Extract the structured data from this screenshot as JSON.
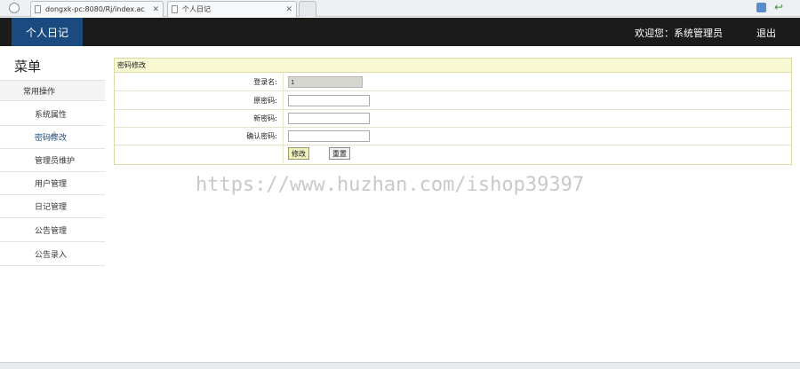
{
  "browser": {
    "tabs": [
      {
        "label": "dongxk-pc:8080/Rj/index.ac"
      },
      {
        "label": "个人日记"
      }
    ],
    "close_glyph": "✕"
  },
  "header": {
    "brand": "个人日记",
    "welcome": "欢迎您：系统管理员",
    "logout": "退出"
  },
  "sidebar": {
    "title": "菜单",
    "group": "常用操作",
    "items": [
      {
        "label": "系统属性"
      },
      {
        "label": "密码修改"
      },
      {
        "label": "管理员维护"
      },
      {
        "label": "用户管理"
      },
      {
        "label": "日记管理"
      },
      {
        "label": "公告管理"
      },
      {
        "label": "公告录入"
      }
    ]
  },
  "form": {
    "title": "密码修改",
    "fields": [
      {
        "label": "登录名:",
        "value": "1"
      },
      {
        "label": "原密码:",
        "value": ""
      },
      {
        "label": "新密码:",
        "value": ""
      },
      {
        "label": "确认密码:",
        "value": ""
      }
    ],
    "submit_label": "修改",
    "reset_label": "重置"
  },
  "watermark": "https://www.huzhan.com/ishop39397",
  "colors": {
    "header_bg": "#1b1b1b",
    "brand_bg": "#1a4a80",
    "panel_head_bg": "#f8f8d2"
  }
}
